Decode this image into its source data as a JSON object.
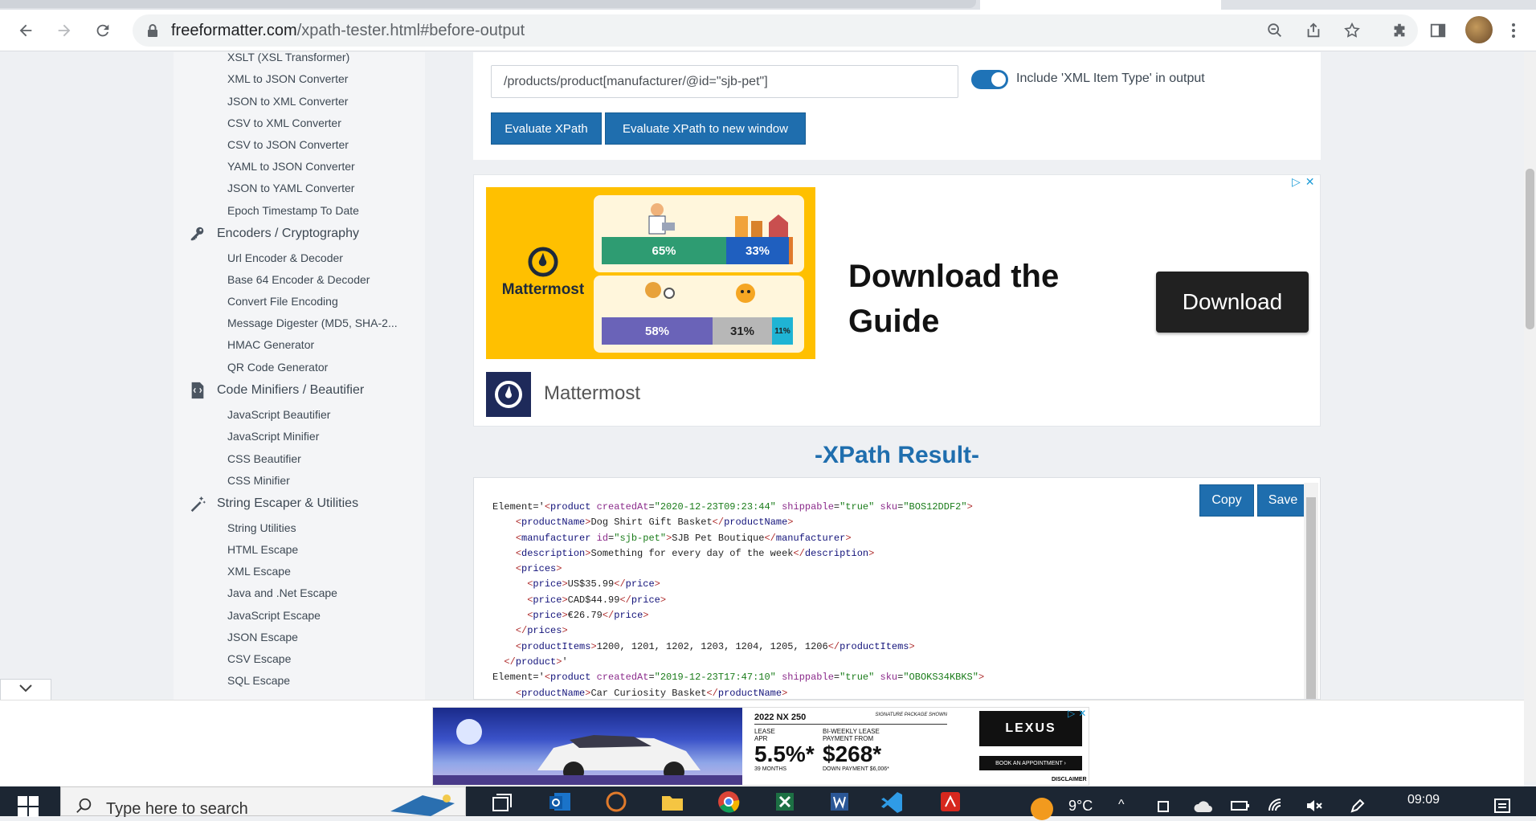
{
  "browser": {
    "url_domain": "freeformatter.com",
    "url_path": "/xpath-tester.html#before-output"
  },
  "sidebar": {
    "top_items": [
      {
        "label": "XSLT (XSL Transformer)"
      },
      {
        "label": "XML to JSON Converter"
      },
      {
        "label": "JSON to XML Converter"
      },
      {
        "label": "CSV to XML Converter"
      },
      {
        "label": "CSV to JSON Converter"
      },
      {
        "label": "YAML to JSON Converter"
      },
      {
        "label": "JSON to YAML Converter"
      },
      {
        "label": "Epoch Timestamp To Date"
      }
    ],
    "cat_encoders": "Encoders / Cryptography",
    "encoder_items": [
      {
        "label": "Url Encoder & Decoder"
      },
      {
        "label": "Base 64 Encoder & Decoder"
      },
      {
        "label": "Convert File Encoding"
      },
      {
        "label": "Message Digester (MD5, SHA-2..."
      },
      {
        "label": "HMAC Generator"
      },
      {
        "label": "QR Code Generator"
      }
    ],
    "cat_minifiers": "Code Minifiers / Beautifier",
    "minifier_items": [
      {
        "label": "JavaScript Beautifier"
      },
      {
        "label": "JavaScript Minifier"
      },
      {
        "label": "CSS Beautifier"
      },
      {
        "label": "CSS Minifier"
      }
    ],
    "cat_escaper": "String Escaper & Utilities",
    "escaper_items": [
      {
        "label": "String Utilities"
      },
      {
        "label": "HTML Escape"
      },
      {
        "label": "XML Escape"
      },
      {
        "label": "Java and .Net Escape"
      },
      {
        "label": "JavaScript Escape"
      },
      {
        "label": "JSON Escape"
      },
      {
        "label": "CSV Escape"
      },
      {
        "label": "SQL Escape"
      }
    ]
  },
  "tester": {
    "xpath_value": "/products/product[manufacturer/@id=\"sjb-pet\"]",
    "toggle_label": "Include 'XML Item Type' in output",
    "toggle_on": true,
    "evaluate_label": "Evaluate XPath",
    "evaluate_new_window_label": "Evaluate XPath to new window"
  },
  "ad": {
    "brand": "Mattermost",
    "headline": "Download the Guide",
    "cta": "Download",
    "advertiser": "Mattermost",
    "bars_top": [
      {
        "label": "65%",
        "value": 65
      },
      {
        "label": "33%",
        "value": 33
      }
    ],
    "bars_bottom": [
      {
        "label": "58%",
        "value": 58
      },
      {
        "label": "31%",
        "value": 31
      },
      {
        "label": "11%",
        "value": 11
      }
    ]
  },
  "result": {
    "title": "-XPath Result-",
    "copy_label": "Copy",
    "save_label": "Save",
    "lines": [
      "Element='<product createdAt=\"2020-12-23T09:23:44\" shippable=\"true\" sku=\"BOS12DDF2\">",
      "    <productName>Dog Shirt Gift Basket</productName>",
      "    <manufacturer id=\"sjb-pet\">SJB Pet Boutique</manufacturer>",
      "    <description>Something for every day of the week</description>",
      "    <prices>",
      "      <price>US$35.99</price>",
      "      <price>CAD$44.99</price>",
      "      <price>€26.79</price>",
      "    </prices>",
      "    <productItems>1200, 1201, 1202, 1203, 1204, 1205, 1206</productItems>",
      "  </product>'",
      "Element='<product createdAt=\"2019-12-23T17:47:10\" shippable=\"true\" sku=\"OBOKS34KBKS\">",
      "    <productName>Car Curiosity Basket</productName>"
    ]
  },
  "bottom_ad": {
    "model": "2022 NX 250",
    "signature": "SIGNATURE PACKAGE SHOWN",
    "lease_label": "LEASE APR",
    "apr": "5.5%*",
    "months": "39 MONTHS",
    "biweekly_label": "BI-WEEKLY LEASE PAYMENT FROM",
    "payment": "$268*",
    "down": "DOWN PAYMENT $6,006*",
    "brand": "LEXUS",
    "cta": "BOOK AN APPOINTMENT ›",
    "disclaimer": "DISCLAIMER"
  },
  "taskbar": {
    "search_placeholder": "Type here to search",
    "temperature": "9°C",
    "time": "09:09"
  }
}
